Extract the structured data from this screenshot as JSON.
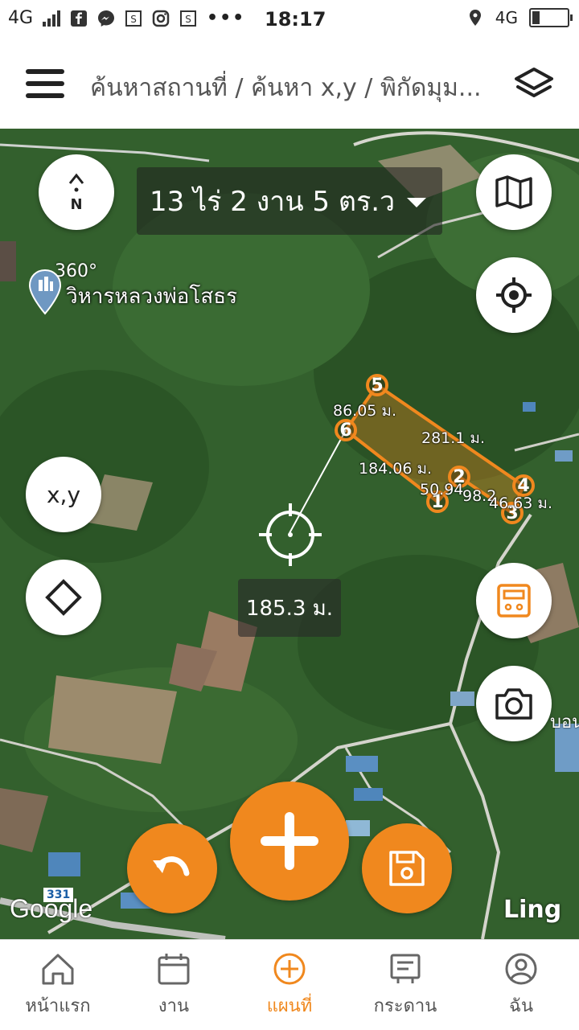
{
  "status_bar": {
    "network_left": "4G",
    "time": "18:17",
    "network_right": "4G",
    "battery_level": 0.2
  },
  "header": {
    "breadcrumb": "ค้นหาสถานที่ / ค้นหา x,y / พิกัดมุม..."
  },
  "map": {
    "area_label": "13 ไร่ 2 งาน 5 ตร.ว",
    "place_name": "วิหารหลวงพ่อโสธร",
    "place_tag": "360°",
    "crosshair_distance": "185.3 ม.",
    "plot_nodes": [
      "1",
      "2",
      "3",
      "4",
      "5",
      "6"
    ],
    "segment_labels": {
      "s56": "86.05 ม.",
      "s54": "281.1 ม.",
      "s61": "184.06 ม.",
      "s12": "50.94",
      "s23": "98.2",
      "s34": "46.63 ม."
    },
    "google_label": "Google",
    "road_sign": "331",
    "corner_text": "Ling",
    "edge_text": "บอน"
  },
  "controls": {
    "xy_label": "x,y",
    "compass_letter": "N"
  },
  "bottom_nav": [
    {
      "label": "หน้าแรก",
      "icon": "home-icon"
    },
    {
      "label": "งาน",
      "icon": "calendar-icon"
    },
    {
      "label": "แผนที่",
      "icon": "plus-circle-icon"
    },
    {
      "label": "กระดาน",
      "icon": "board-icon"
    },
    {
      "label": "ฉัน",
      "icon": "user-icon"
    }
  ],
  "colors": {
    "accent": "#f0881e",
    "map_green": "#2f5a2a"
  }
}
